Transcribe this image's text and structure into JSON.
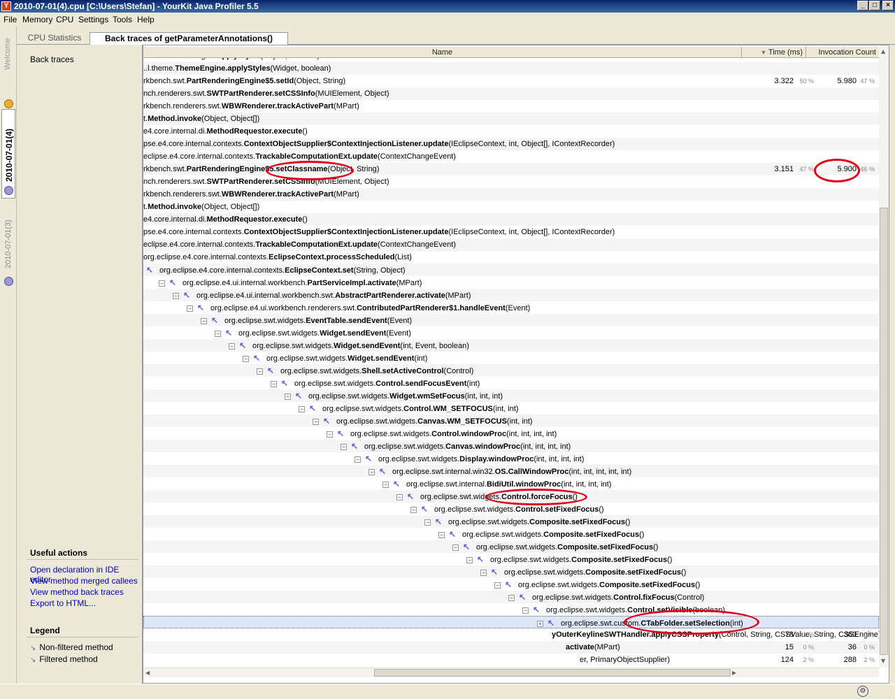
{
  "window": {
    "title": "2010-07-01(4).cpu [C:\\Users\\Stefan] - YourKit Java Profiler 5.5",
    "minimize": "_",
    "maximize": "□",
    "close": "×"
  },
  "menu": [
    "File",
    "Memory",
    "CPU",
    "Settings",
    "Tools",
    "Help"
  ],
  "side_tabs": {
    "welcome": "Welcome",
    "snapshot_active": "2010-07-01(4)",
    "snapshot_other": "2010-07-01(3)"
  },
  "tabs": {
    "cpu_statistics": "CPU Statistics",
    "back_traces": "Back traces of getParameterAnnotations()"
  },
  "left_panel": {
    "title": "Back traces",
    "useful_actions_title": "Useful actions",
    "actions": [
      "Open declaration in IDE editor",
      "View method merged callees",
      "View method back traces",
      "Export to HTML..."
    ],
    "legend_title": "Legend",
    "legend": [
      "Non-filtered method",
      "Filtered method"
    ]
  },
  "columns": {
    "name": "Name",
    "time": "Time (ms)",
    "count": "Invocation Count"
  },
  "rows": [
    {
      "pre": "..AbstractCSSEngine.",
      "b": "applyStyles",
      "post": "(Object, boolean)",
      "t": "",
      "tp": "",
      "c": "",
      "cp": ""
    },
    {
      "pre": "..l.theme.",
      "b": "ThemeEngine.applyStyles",
      "post": "(Widget, boolean)",
      "t": "",
      "tp": "",
      "c": "",
      "cp": ""
    },
    {
      "pre": "rkbench.swt.",
      "b": "PartRenderingEngine$5.setId",
      "post": "(Object, String)",
      "t": "3.322",
      "tp": "50 %",
      "c": "5.980",
      "cp": "47 %"
    },
    {
      "pre": "nch.renderers.swt.",
      "b": "SWTPartRenderer.setCSSInfo",
      "post": "(MUIElement, Object)",
      "t": "",
      "tp": "",
      "c": "",
      "cp": ""
    },
    {
      "pre": "rkbench.renderers.swt.",
      "b": "WBWRenderer.trackActivePart",
      "post": "(MPart)",
      "t": "",
      "tp": "",
      "c": "",
      "cp": ""
    },
    {
      "pre": "t.",
      "b": "Method.invoke",
      "post": "(Object, Object[])",
      "t": "",
      "tp": "",
      "c": "",
      "cp": ""
    },
    {
      "pre": "e4.core.internal.di.",
      "b": "MethodRequestor.execute",
      "post": "()",
      "t": "",
      "tp": "",
      "c": "",
      "cp": ""
    },
    {
      "pre": "pse.e4.core.internal.contexts.",
      "b": "ContextObjectSupplier$ContextInjectionListener.update",
      "post": "(IEclipseContext, int, Object[], IContextRecorder)",
      "t": "",
      "tp": "",
      "c": "",
      "cp": ""
    },
    {
      "pre": "eclipse.e4.core.internal.contexts.",
      "b": "TrackableComputationExt.update",
      "post": "(ContextChangeEvent)",
      "t": "",
      "tp": "",
      "c": "",
      "cp": ""
    },
    {
      "pre": "rkbench.swt.",
      "b": "PartRenderingEngine$5.setClassname",
      "post": "(Object, String)",
      "t": "3.151",
      "tp": "47 %",
      "c": "5.900",
      "cp": "46 %"
    },
    {
      "pre": "nch.renderers.swt.",
      "b": "SWTPartRenderer.setCSSInfo",
      "post": "(MUIElement, Object)",
      "t": "",
      "tp": "",
      "c": "",
      "cp": ""
    },
    {
      "pre": "rkbench.renderers.swt.",
      "b": "WBWRenderer.trackActivePart",
      "post": "(MPart)",
      "t": "",
      "tp": "",
      "c": "",
      "cp": ""
    },
    {
      "pre": "t.",
      "b": "Method.invoke",
      "post": "(Object, Object[])",
      "t": "",
      "tp": "",
      "c": "",
      "cp": ""
    },
    {
      "pre": "e4.core.internal.di.",
      "b": "MethodRequestor.execute",
      "post": "()",
      "t": "",
      "tp": "",
      "c": "",
      "cp": ""
    },
    {
      "pre": "pse.e4.core.internal.contexts.",
      "b": "ContextObjectSupplier$ContextInjectionListener.update",
      "post": "(IEclipseContext, int, Object[], IContextRecorder)",
      "t": "",
      "tp": "",
      "c": "",
      "cp": ""
    },
    {
      "pre": "eclipse.e4.core.internal.contexts.",
      "b": "TrackableComputationExt.update",
      "post": "(ContextChangeEvent)",
      "t": "",
      "tp": "",
      "c": "",
      "cp": ""
    },
    {
      "pre": "org.eclipse.e4.core.internal.contexts.",
      "b": "EclipseContext.processScheduled",
      "post": "(List)",
      "t": "",
      "tp": "",
      "c": "",
      "cp": ""
    },
    {
      "pre": "org.eclipse.e4.core.internal.contexts.",
      "b": "EclipseContext.set",
      "post": "(String, Object)",
      "t": "",
      "tp": "",
      "c": "",
      "cp": "",
      "arrow": true
    },
    {
      "pre": "org.eclipse.e4.ui.internal.workbench.",
      "b": "PartServiceImpl.activate",
      "post": "(MPart)",
      "t": "",
      "tp": "",
      "c": "",
      "cp": "",
      "arrow": true,
      "tog": "−"
    },
    {
      "pre": "org.eclipse.e4.ui.internal.workbench.swt.",
      "b": "AbstractPartRenderer.activate",
      "post": "(MPart)",
      "t": "",
      "tp": "",
      "c": "",
      "cp": "",
      "arrow": true,
      "tog": "−"
    },
    {
      "pre": "org.eclipse.e4.ui.workbench.renderers.swt.",
      "b": "ContributedPartRenderer$1.handleEvent",
      "post": "(Event)",
      "t": "",
      "tp": "",
      "c": "",
      "cp": "",
      "arrow": true,
      "tog": "−"
    },
    {
      "pre": "org.eclipse.swt.widgets.",
      "b": "EventTable.sendEvent",
      "post": "(Event)",
      "t": "",
      "tp": "",
      "c": "",
      "cp": "",
      "arrow": true,
      "tog": "−"
    },
    {
      "pre": "org.eclipse.swt.widgets.",
      "b": "Widget.sendEvent",
      "post": "(Event)",
      "t": "",
      "tp": "",
      "c": "",
      "cp": "",
      "arrow": true,
      "tog": "−"
    },
    {
      "pre": "org.eclipse.swt.widgets.",
      "b": "Widget.sendEvent",
      "post": "(int, Event, boolean)",
      "t": "",
      "tp": "",
      "c": "",
      "cp": "",
      "arrow": true,
      "tog": "−"
    },
    {
      "pre": "org.eclipse.swt.widgets.",
      "b": "Widget.sendEvent",
      "post": "(int)",
      "t": "",
      "tp": "",
      "c": "",
      "cp": "",
      "arrow": true,
      "tog": "−"
    },
    {
      "pre": "org.eclipse.swt.widgets.",
      "b": "Shell.setActiveControl",
      "post": "(Control)",
      "t": "",
      "tp": "",
      "c": "",
      "cp": "",
      "arrow": true,
      "tog": "−"
    },
    {
      "pre": "org.eclipse.swt.widgets.",
      "b": "Control.sendFocusEvent",
      "post": "(int)",
      "t": "",
      "tp": "",
      "c": "",
      "cp": "",
      "arrow": true,
      "tog": "−"
    },
    {
      "pre": "org.eclipse.swt.widgets.",
      "b": "Widget.wmSetFocus",
      "post": "(int, int, int)",
      "t": "",
      "tp": "",
      "c": "",
      "cp": "",
      "arrow": true,
      "tog": "−"
    },
    {
      "pre": "org.eclipse.swt.widgets.",
      "b": "Control.WM_SETFOCUS",
      "post": "(int, int)",
      "t": "",
      "tp": "",
      "c": "",
      "cp": "",
      "arrow": true,
      "tog": "−"
    },
    {
      "pre": "org.eclipse.swt.widgets.",
      "b": "Canvas.WM_SETFOCUS",
      "post": "(int, int)",
      "t": "",
      "tp": "",
      "c": "",
      "cp": "",
      "arrow": true,
      "tog": "−"
    },
    {
      "pre": "org.eclipse.swt.widgets.",
      "b": "Control.windowProc",
      "post": "(int, int, int, int)",
      "t": "",
      "tp": "",
      "c": "",
      "cp": "",
      "arrow": true,
      "tog": "−"
    },
    {
      "pre": "org.eclipse.swt.widgets.",
      "b": "Canvas.windowProc",
      "post": "(int, int, int, int)",
      "t": "",
      "tp": "",
      "c": "",
      "cp": "",
      "arrow": true,
      "tog": "−"
    },
    {
      "pre": "org.eclipse.swt.widgets.",
      "b": "Display.windowProc",
      "post": "(int, int, int, int)",
      "t": "",
      "tp": "",
      "c": "",
      "cp": "",
      "arrow": true,
      "tog": "−"
    },
    {
      "pre": "org.eclipse.swt.internal.win32.",
      "b": "OS.CallWindowProc",
      "post": "(int, int, int, int, int)",
      "t": "",
      "tp": "",
      "c": "",
      "cp": "",
      "arrow": true,
      "tog": "−"
    },
    {
      "pre": "org.eclipse.swt.internal.",
      "b": "BidiUtil.windowProc",
      "post": "(int, int, int, int)",
      "t": "",
      "tp": "",
      "c": "",
      "cp": "",
      "arrow": true,
      "tog": "−"
    },
    {
      "pre": "org.eclipse.swt.widgets.",
      "b": "Control.forceFocus",
      "post": "()",
      "t": "",
      "tp": "",
      "c": "",
      "cp": "",
      "arrow": true,
      "tog": "−"
    },
    {
      "pre": "org.eclipse.swt.widgets.",
      "b": "Control.setFixedFocus",
      "post": "()",
      "t": "",
      "tp": "",
      "c": "",
      "cp": "",
      "arrow": true,
      "tog": "−"
    },
    {
      "pre": "org.eclipse.swt.widgets.",
      "b": "Composite.setFixedFocus",
      "post": "()",
      "t": "",
      "tp": "",
      "c": "",
      "cp": "",
      "arrow": true,
      "tog": "−"
    },
    {
      "pre": "org.eclipse.swt.widgets.",
      "b": "Composite.setFixedFocus",
      "post": "()",
      "t": "",
      "tp": "",
      "c": "",
      "cp": "",
      "arrow": true,
      "tog": "−"
    },
    {
      "pre": "org.eclipse.swt.widgets.",
      "b": "Composite.setFixedFocus",
      "post": "()",
      "t": "",
      "tp": "",
      "c": "",
      "cp": "",
      "arrow": true,
      "tog": "−"
    },
    {
      "pre": "org.eclipse.swt.widgets.",
      "b": "Composite.setFixedFocus",
      "post": "()",
      "t": "",
      "tp": "",
      "c": "",
      "cp": "",
      "arrow": true,
      "tog": "−"
    },
    {
      "pre": "org.eclipse.swt.widgets.",
      "b": "Composite.setFixedFocus",
      "post": "()",
      "t": "",
      "tp": "",
      "c": "",
      "cp": "",
      "arrow": true,
      "tog": "−"
    },
    {
      "pre": "org.eclipse.swt.widgets.",
      "b": "Composite.setFixedFocus",
      "post": "()",
      "t": "",
      "tp": "",
      "c": "",
      "cp": "",
      "arrow": true,
      "tog": "−"
    },
    {
      "pre": "org.eclipse.swt.widgets.",
      "b": "Control.fixFocus",
      "post": "(Control)",
      "t": "",
      "tp": "",
      "c": "",
      "cp": "",
      "arrow": true,
      "tog": "−"
    },
    {
      "pre": "org.eclipse.swt.widgets.",
      "b": "Control.setVisible",
      "post": "(boolean)",
      "t": "",
      "tp": "",
      "c": "",
      "cp": "",
      "arrow": true,
      "tog": "−"
    },
    {
      "pre": "org.eclipse.swt.custom.",
      "b": "CTabFolder.setSelection",
      "post": "(int)",
      "t": "",
      "tp": "",
      "c": "",
      "cp": "",
      "arrow": true,
      "tog": "+",
      "sel": true
    },
    {
      "pre": "",
      "b": "yOuterKeylineSWTHandler.applyCSSProperty",
      "post": "(Control, String, CSSValue, String, CSSEngine)",
      "t": "78",
      "tp": "1 %",
      "c": "360",
      "cp": "3 %"
    },
    {
      "pre": "",
      "b": "activate",
      "post": "(MPart)",
      "t": "15",
      "tp": "0 %",
      "c": "36",
      "cp": "0 %"
    },
    {
      "pre": "er, PrimaryObjectSupplier)",
      "b": "",
      "post": "",
      "t": "124",
      "tp": "2 %",
      "c": "288",
      "cp": "2 %"
    }
  ]
}
